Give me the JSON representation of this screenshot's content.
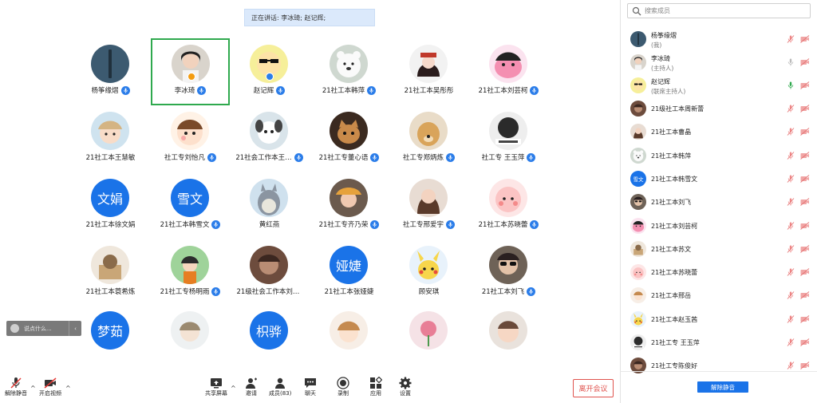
{
  "speaking": "正在讲话: 李冰琦; 赵记辉;",
  "grid": [
    {
      "name": "杨筝缘熠",
      "avatar": "photo-dark-phone",
      "mic": true
    },
    {
      "name": "李冰琦",
      "avatar": "photo-girl",
      "mic": true,
      "active": true,
      "badge": "orange"
    },
    {
      "name": "赵记辉",
      "avatar": "cartoon-sunglasses",
      "mic": true,
      "badge": "blue"
    },
    {
      "name": "21社工本韩萍",
      "avatar": "cartoon-bear",
      "mic": true
    },
    {
      "name": "21社工本吴彤彤",
      "avatar": "anime-girl",
      "mic": false
    },
    {
      "name": "21社工本刘芸柯",
      "avatar": "cartoon-pink",
      "mic": true
    },
    {
      "name": "21社工本王慧敏",
      "avatar": "cartoon-girl-hat",
      "mic": false
    },
    {
      "name": "社工专刘怡凡",
      "avatar": "cartoon-face",
      "mic": true
    },
    {
      "name": "21社会工作本王…",
      "avatar": "cartoon-puppy",
      "mic": true
    },
    {
      "name": "21社工专董心语",
      "avatar": "photo-cat",
      "mic": true
    },
    {
      "name": "社工专郑炳炼",
      "avatar": "photo-dog",
      "mic": true
    },
    {
      "name": "社工专 王玉萍",
      "avatar": "meme-dark",
      "mic": true
    },
    {
      "name": "21社工本徐文娟",
      "avatar": "text",
      "text": "文娟",
      "mic": false
    },
    {
      "name": "21社工本韩雪文",
      "avatar": "text",
      "text": "雪文",
      "mic": true
    },
    {
      "name": "黄红燕",
      "avatar": "cartoon-totoro",
      "mic": false
    },
    {
      "name": "21社工专齐乃荣",
      "avatar": "photo-girl-hat",
      "mic": true
    },
    {
      "name": "社工专邢爱宇",
      "avatar": "photo-girl-hair",
      "mic": true
    },
    {
      "name": "21社工本苏晓蕾",
      "avatar": "cartoon-pink-blob",
      "mic": true
    },
    {
      "name": "21社工本蓑希炼",
      "avatar": "photo-cat-box",
      "mic": false
    },
    {
      "name": "21社工专杨明雨",
      "avatar": "anime-boy",
      "mic": true
    },
    {
      "name": "21级社会工作本刘丽…",
      "avatar": "photo-brown",
      "mic": false
    },
    {
      "name": "21社工本张娅婕",
      "avatar": "text",
      "text": "娅婕",
      "mic": false
    },
    {
      "name": "顾安琪",
      "avatar": "cartoon-pikachu",
      "mic": false
    },
    {
      "name": "21社工本刘飞",
      "avatar": "photo-sunglasses",
      "mic": true
    },
    {
      "name": "",
      "avatar": "text",
      "text": "梦茹",
      "mic": false
    },
    {
      "name": "",
      "avatar": "anime-sketch",
      "mic": false
    },
    {
      "name": "",
      "avatar": "text",
      "text": "枳骅",
      "mic": false
    },
    {
      "name": "",
      "avatar": "anime-kid",
      "mic": false
    },
    {
      "name": "",
      "avatar": "photo-flower",
      "mic": false
    },
    {
      "name": "",
      "avatar": "photo-baby",
      "mic": false
    }
  ],
  "chat_placeholder": "说点什么...",
  "toolbar": {
    "unmute": "解除静音",
    "video": "开启视频",
    "share": "共享屏幕",
    "invite": "邀请",
    "members": "成员(83)",
    "chat": "聊天",
    "record": "录制",
    "apps": "应用",
    "settings": "设置",
    "leave": "离开会议"
  },
  "sidebar": {
    "search_placeholder": "搜索成员",
    "unmute_all": "解除静音",
    "members": [
      {
        "name": "杨筝缘熠",
        "sub": "(我)",
        "avatar": "photo-dark-phone",
        "mic": "muted"
      },
      {
        "name": "李冰琦",
        "sub": "(主持人)",
        "avatar": "photo-girl",
        "mic": "on-gray"
      },
      {
        "name": "赵记辉",
        "sub": "(联席主持人)",
        "avatar": "cartoon-sunglasses",
        "mic": "speaking"
      },
      {
        "name": "21级社工本周新蕾",
        "avatar": "photo-brown",
        "mic": "muted"
      },
      {
        "name": "21社工本曹晶",
        "avatar": "photo-girl-hair",
        "mic": "muted"
      },
      {
        "name": "21社工本韩萍",
        "avatar": "cartoon-bear",
        "mic": "muted"
      },
      {
        "name": "21社工本韩雪文",
        "avatar": "text",
        "text": "雪文",
        "mic": "muted"
      },
      {
        "name": "21社工本刘飞",
        "avatar": "photo-sunglasses",
        "mic": "muted"
      },
      {
        "name": "21社工本刘芸柯",
        "avatar": "cartoon-pink",
        "mic": "muted"
      },
      {
        "name": "21社工本苏文",
        "avatar": "photo-cat-box",
        "mic": "muted"
      },
      {
        "name": "21社工本苏晓蕾",
        "avatar": "cartoon-pink-blob",
        "mic": "muted"
      },
      {
        "name": "21社工本邢岳",
        "avatar": "anime-kid",
        "mic": "muted"
      },
      {
        "name": "21社工本赵玉茜",
        "avatar": "cartoon-pikachu",
        "mic": "muted"
      },
      {
        "name": "21社工专 王玉萍",
        "avatar": "meme-dark",
        "mic": "muted"
      },
      {
        "name": "21社工专陈俊好",
        "avatar": "photo-brown",
        "mic": "muted"
      }
    ]
  },
  "colors": {
    "accent": "#1a73e8",
    "mic_blue": "#2b7de9",
    "active_border": "#2fa94e",
    "leave": "#e0534e",
    "muted_red": "#e57373"
  }
}
